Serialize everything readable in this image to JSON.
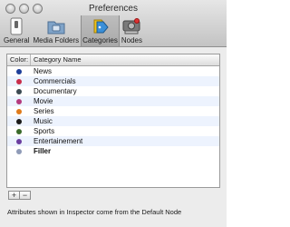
{
  "window": {
    "title": "Preferences"
  },
  "toolbar": {
    "items": [
      {
        "label": "General",
        "icon": "switch-icon"
      },
      {
        "label": "Media Folders",
        "icon": "folder-icon"
      },
      {
        "label": "Categories",
        "icon": "tags-icon",
        "selected": true
      },
      {
        "label": "Nodes",
        "icon": "node-icon"
      }
    ]
  },
  "table": {
    "columns": [
      "Color",
      "Category Name"
    ],
    "rows": [
      {
        "name": "News",
        "color": "#1e3f9a",
        "bold": false
      },
      {
        "name": "Commercials",
        "color": "#c92d4b",
        "bold": false
      },
      {
        "name": "Documentary",
        "color": "#3b4a52",
        "bold": false
      },
      {
        "name": "Movie",
        "color": "#b43a7e",
        "bold": false
      },
      {
        "name": "Series",
        "color": "#e07b1c",
        "bold": false
      },
      {
        "name": "Music",
        "color": "#1a1a1a",
        "bold": false
      },
      {
        "name": "Sports",
        "color": "#3a6a2b",
        "bold": false
      },
      {
        "name": "Entertainement",
        "color": "#6b3ea0",
        "bold": false
      },
      {
        "name": "Filler",
        "color": "#8f9bb7",
        "bold": true
      }
    ]
  },
  "buttons": {
    "add": "+",
    "remove": "−"
  },
  "footer": {
    "text": "Attributes shown in Inspector come from the Default Node"
  }
}
